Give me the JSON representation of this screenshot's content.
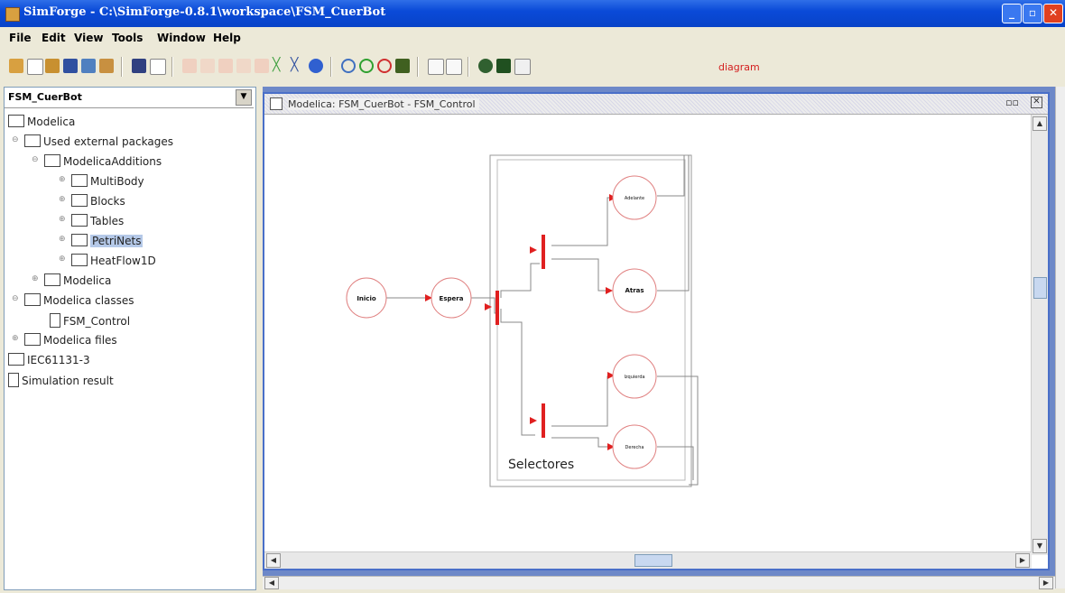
{
  "window": {
    "title": "SimForge - C:\\SimForge-0.8.1\\workspace\\FSM_CuerBot"
  },
  "menu": [
    "File",
    "Edit",
    "View",
    "Tools",
    "Window",
    "Help"
  ],
  "toolbar": {
    "mode_label": "diagram"
  },
  "left_panel": {
    "combo_value": "FSM_CuerBot",
    "tree": [
      {
        "label": "Modelica",
        "icon": "folder-icon"
      },
      {
        "label": "Used external packages",
        "icon": "folder-icon"
      },
      {
        "label": "ModelicaAdditions",
        "icon": "folder-icon"
      },
      {
        "label": "MultiBody",
        "icon": "folder-icon"
      },
      {
        "label": "Blocks",
        "icon": "folder-icon"
      },
      {
        "label": "Tables",
        "icon": "folder-icon"
      },
      {
        "label": "PetriNets",
        "icon": "folder-icon",
        "selected": true
      },
      {
        "label": "HeatFlow1D",
        "icon": "folder-icon"
      },
      {
        "label": "Modelica",
        "icon": "folder-icon"
      },
      {
        "label": "Modelica classes",
        "icon": "folder-icon"
      },
      {
        "label": "FSM_Control",
        "icon": "document-icon"
      },
      {
        "label": "Modelica files",
        "icon": "folder-icon"
      },
      {
        "label": "IEC61131-3",
        "icon": "folder-icon"
      },
      {
        "label": "Simulation result",
        "icon": "document-icon"
      }
    ]
  },
  "document": {
    "title": "Modelica: FSM_CuerBot - FSM_Control",
    "diagram": {
      "places": [
        "Inicio",
        "Espera",
        "Adelante",
        "Atras",
        "Izquierda",
        "Derecha"
      ],
      "group_label": "Selectores"
    }
  },
  "colors": {
    "title_bar": "#0a4ad8",
    "petri_red": "#e02020",
    "desktop": "#6d88c8"
  }
}
